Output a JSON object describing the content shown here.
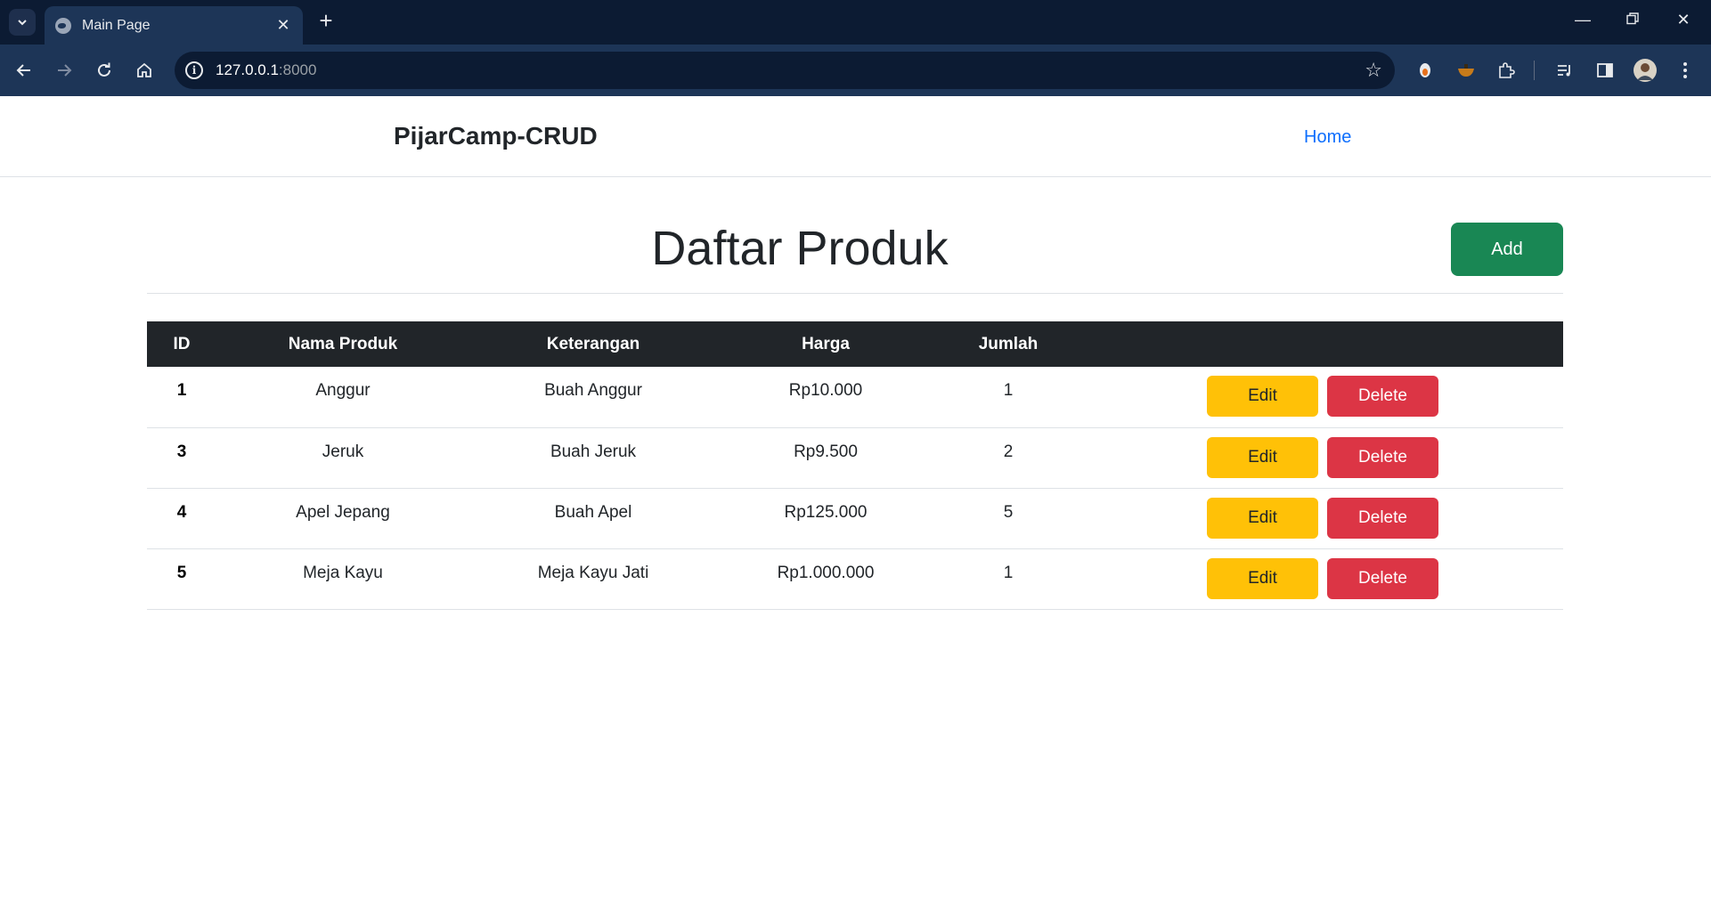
{
  "browser": {
    "tab_title": "Main Page",
    "url_host": "127.0.0.1",
    "url_port": ":8000"
  },
  "navbar": {
    "brand": "PijarCamp-CRUD",
    "links": [
      "Home"
    ]
  },
  "main": {
    "heading": "Daftar Produk",
    "add_label": "Add"
  },
  "table": {
    "headers": [
      "ID",
      "Nama Produk",
      "Keterangan",
      "Harga",
      "Jumlah",
      ""
    ],
    "rows": [
      {
        "id": "1",
        "nama": "Anggur",
        "keterangan": "Buah Anggur",
        "harga": "Rp10.000",
        "jumlah": "1"
      },
      {
        "id": "3",
        "nama": "Jeruk",
        "keterangan": "Buah Jeruk",
        "harga": "Rp9.500",
        "jumlah": "2"
      },
      {
        "id": "4",
        "nama": "Apel Jepang",
        "keterangan": "Buah Apel",
        "harga": "Rp125.000",
        "jumlah": "5"
      },
      {
        "id": "5",
        "nama": "Meja Kayu",
        "keterangan": "Meja Kayu Jati",
        "harga": "Rp1.000.000",
        "jumlah": "1"
      }
    ],
    "edit_label": "Edit",
    "delete_label": "Delete"
  },
  "colors": {
    "chrome_bg": "#0c1b33",
    "toolbar_bg": "#1d3557",
    "add_button": "#198754",
    "edit_button": "#ffc107",
    "delete_button": "#dc3545",
    "table_header": "#212529",
    "link": "#0d6efd"
  },
  "icons": {
    "tab_search": "chevron-down-icon",
    "favicon": "globe-icon",
    "back": "arrow-left-icon",
    "forward": "arrow-right-icon",
    "reload": "reload-icon",
    "home": "home-icon",
    "site_info": "info-icon",
    "bookmark": "star-icon",
    "extensions": "puzzle-icon",
    "media": "media-control-icon",
    "side_panel": "side-panel-icon",
    "profile": "avatar",
    "menu": "kebab-menu-icon"
  }
}
